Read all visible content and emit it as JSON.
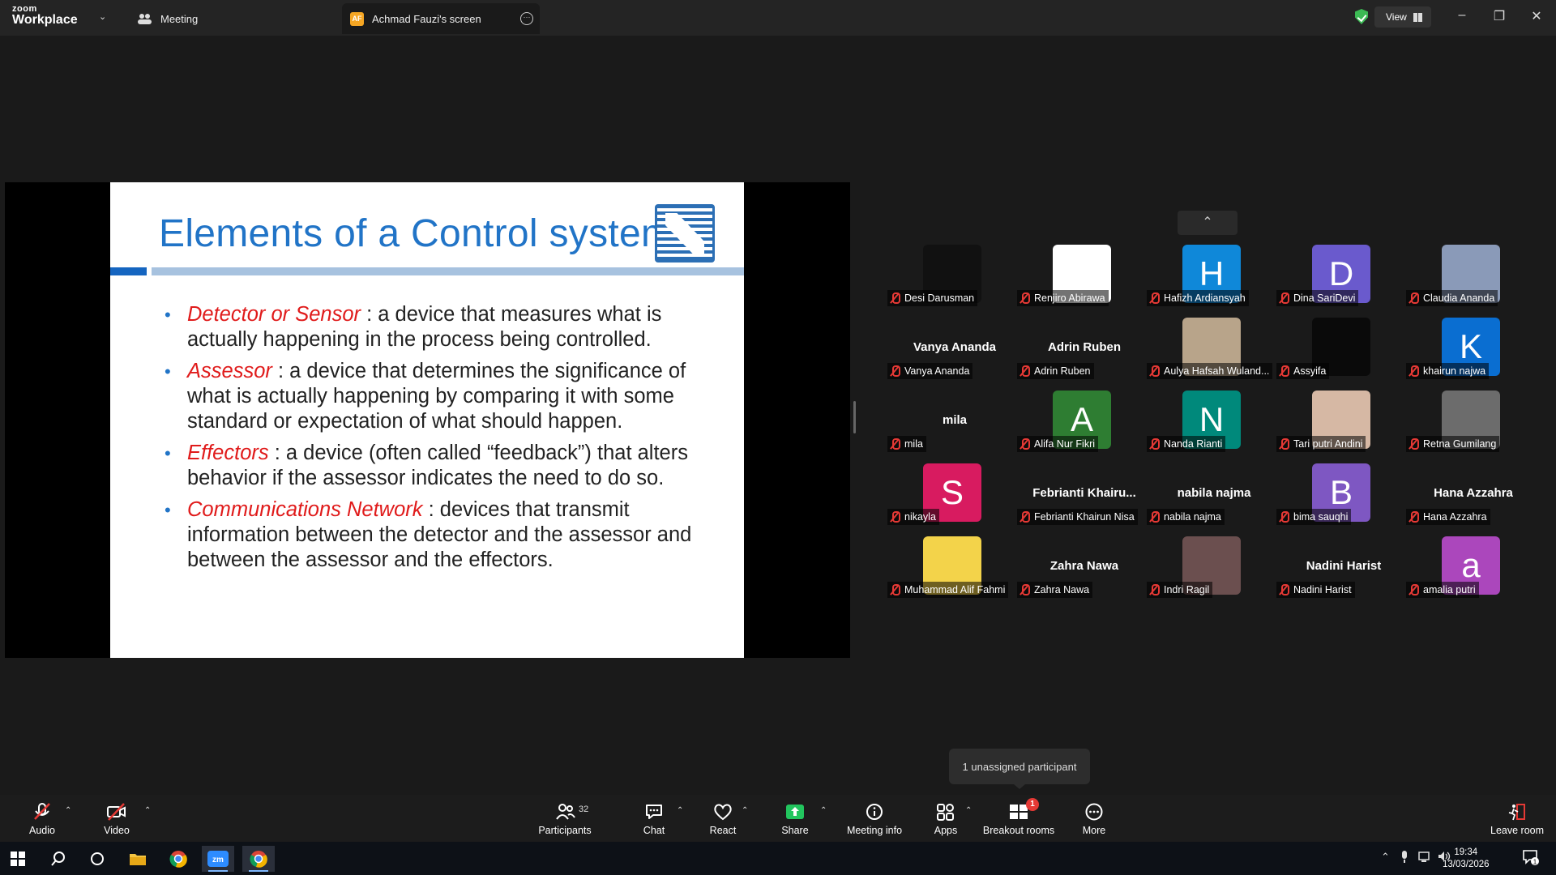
{
  "app": {
    "logo_top": "zoom",
    "logo_bottom": "Workplace",
    "tab_meeting": "Meeting",
    "tab_screen_badge": "AF",
    "tab_screen": "Achmad Fauzi's screen",
    "view_label": "View"
  },
  "slide": {
    "title": "Elements of a Control system",
    "bullets": [
      {
        "term": "Detector or Sensor",
        "text": " : a device that measures what is actually happening in the process being controlled."
      },
      {
        "term": " Assessor",
        "text": " : a device that determines the significance of what is actually happening by comparing it with some standard or expectation of what should happen."
      },
      {
        "term": "Effectors",
        "text": " : a device (often called “feedback”) that alters behavior if the assessor indicates the need to do so."
      },
      {
        "term": "Communications Network",
        "text": " : devices that transmit information between the detector and the assessor and between the assessor and the effectors."
      }
    ]
  },
  "participants": [
    {
      "name": "Desi Darusman",
      "type": "video",
      "color": "#111111"
    },
    {
      "name": "Renjiro Abirawa",
      "type": "video",
      "color": "#ffffff"
    },
    {
      "name": "Hafizh Ardiansyah",
      "type": "initial",
      "initial": "H",
      "color": "#0f88d9"
    },
    {
      "name": "Dina SariDevi",
      "type": "initial",
      "initial": "D",
      "color": "#6a5acd"
    },
    {
      "name": "Claudia Ananda",
      "type": "video",
      "color": "#8a9ab8"
    },
    {
      "name": "Vanya Ananda",
      "type": "name",
      "display": "Vanya Ananda"
    },
    {
      "name": "Adrin Ruben",
      "type": "name",
      "display": "Adrin Ruben"
    },
    {
      "name": "Aulya Hafsah Wuland...",
      "type": "video",
      "color": "#b8a48a"
    },
    {
      "name": "Assyifa",
      "type": "video",
      "color": "#0a0a0a"
    },
    {
      "name": "khairun najwa",
      "type": "initial",
      "initial": "K",
      "color": "#0a6ed1"
    },
    {
      "name": "mila",
      "type": "name",
      "display": "mila"
    },
    {
      "name": "Alifa Nur Fikri",
      "type": "initial",
      "initial": "A",
      "color": "#2e7d32"
    },
    {
      "name": "Nanda Rianti",
      "type": "initial",
      "initial": "N",
      "color": "#00897b"
    },
    {
      "name": "Tari putri Andini",
      "type": "video",
      "color": "#d6b8a4"
    },
    {
      "name": "Retna Gumilang",
      "type": "video",
      "color": "#6c6c6c"
    },
    {
      "name": "nikayla",
      "type": "initial",
      "initial": "S",
      "color": "#d81b60"
    },
    {
      "name": "Febrianti Khairun Nisa",
      "type": "name",
      "display": "Febrianti  Khairu..."
    },
    {
      "name": "nabila najma",
      "type": "name",
      "display": "nabila najma"
    },
    {
      "name": "bima sauqhi",
      "type": "initial",
      "initial": "B",
      "color": "#7e57c2"
    },
    {
      "name": "Hana Azzahra",
      "type": "name",
      "display": "Hana Azzahra"
    },
    {
      "name": "Muhammad Alif Fahmi",
      "type": "video",
      "color": "#f3d34a"
    },
    {
      "name": "Zahra Nawa",
      "type": "name",
      "display": "Zahra Nawa"
    },
    {
      "name": "Indri Ragil",
      "type": "video",
      "color": "#6b4f4f"
    },
    {
      "name": "Nadini Harist",
      "type": "name",
      "display": "Nadini Harist"
    },
    {
      "name": "amalia putri",
      "type": "initial",
      "initial": "a",
      "color": "#ab47bc"
    }
  ],
  "tooltip": "1 unassigned participant",
  "toolbar": {
    "audio": "Audio",
    "video": "Video",
    "participants": "Participants",
    "participants_count": "32",
    "chat": "Chat",
    "react": "React",
    "share": "Share",
    "meeting_info": "Meeting info",
    "apps": "Apps",
    "breakout": "Breakout rooms",
    "breakout_badge": "1",
    "more": "More",
    "leave": "Leave room"
  },
  "taskbar": {
    "time": "19:34",
    "date": "13/03/2026",
    "notif": "1"
  }
}
